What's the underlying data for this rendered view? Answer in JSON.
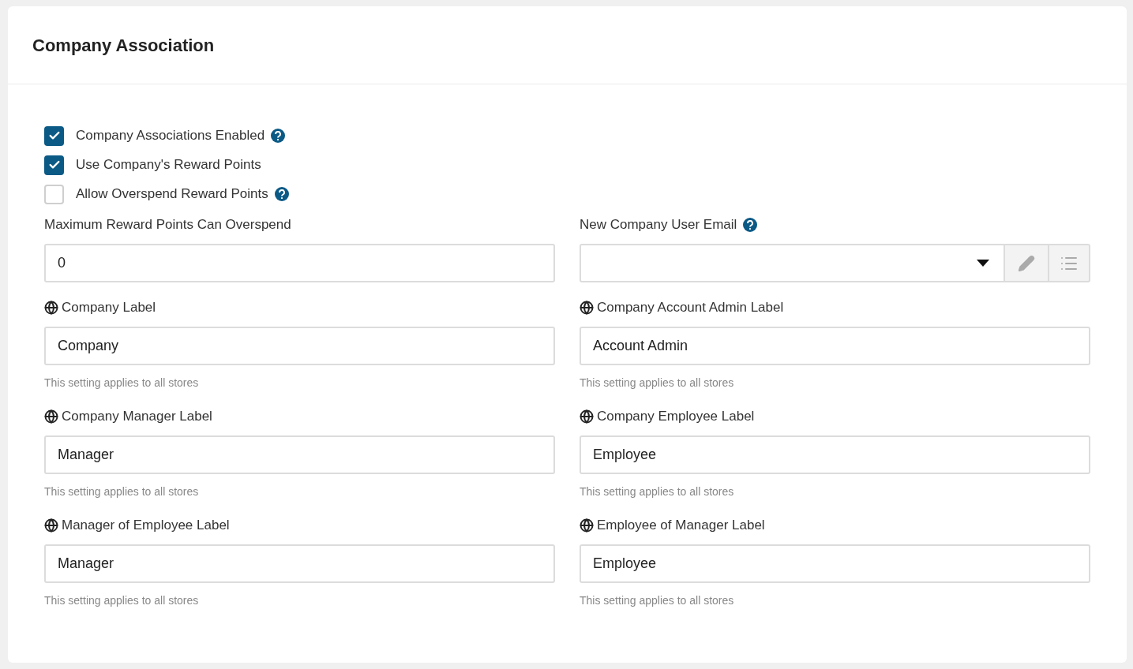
{
  "title": "Company Association",
  "checkboxes": [
    {
      "label": "Company Associations Enabled",
      "checked": true,
      "help": true
    },
    {
      "label": "Use Company's Reward Points",
      "checked": true,
      "help": false
    },
    {
      "label": "Allow Overspend Reward Points",
      "checked": false,
      "help": true
    }
  ],
  "fields": [
    {
      "kind": "text",
      "label": "Maximum Reward Points Can Overspend",
      "value": "0",
      "translatable": false,
      "help": false
    },
    {
      "kind": "select",
      "label": "New Company User Email",
      "translatable": false,
      "help": true
    },
    {
      "kind": "text",
      "label": "Company Label",
      "value": "Company",
      "translatable": true,
      "help": false,
      "hint": "This setting applies to all stores"
    },
    {
      "kind": "text",
      "label": "Company Account Admin Label",
      "value": "Account Admin",
      "translatable": true,
      "help": false,
      "hint": "This setting applies to all stores"
    },
    {
      "kind": "text",
      "label": "Company Manager Label",
      "value": "Manager",
      "translatable": true,
      "help": false,
      "hint": "This setting applies to all stores"
    },
    {
      "kind": "text",
      "label": "Company Employee Label",
      "value": "Employee",
      "translatable": true,
      "help": false,
      "hint": "This setting applies to all stores"
    },
    {
      "kind": "text",
      "label": "Manager of Employee Label",
      "value": "Manager",
      "translatable": true,
      "help": false,
      "hint": "This setting applies to all stores"
    },
    {
      "kind": "text",
      "label": "Employee of Manager Label",
      "value": "Employee",
      "translatable": true,
      "help": false,
      "hint": "This setting applies to all stores"
    }
  ]
}
